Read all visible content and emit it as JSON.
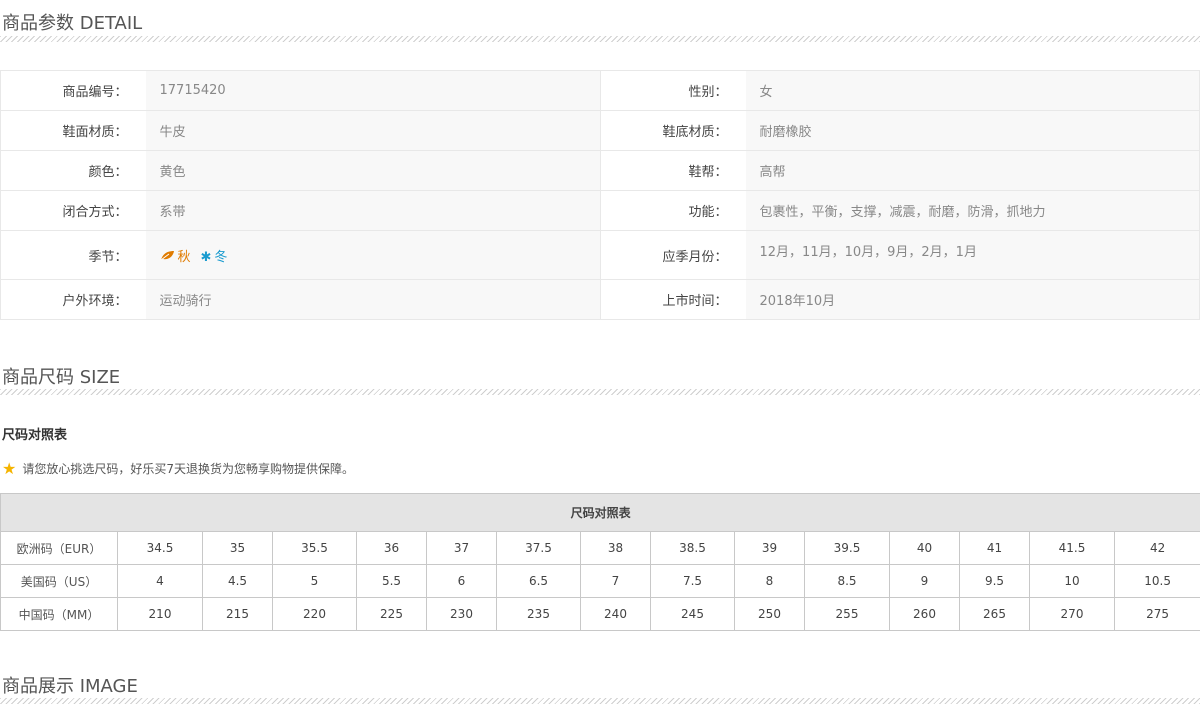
{
  "detail_section": {
    "title": "商品参数 DETAIL"
  },
  "detail": {
    "rows": [
      [
        {
          "k": "商品编号：",
          "v": "17715420"
        },
        {
          "k": "性别：",
          "v": "女"
        }
      ],
      [
        {
          "k": "鞋面材质：",
          "v": "牛皮"
        },
        {
          "k": "鞋底材质：",
          "v": "耐磨橡胶"
        }
      ],
      [
        {
          "k": "颜色：",
          "v": "黄色"
        },
        {
          "k": "鞋帮：",
          "v": "高帮"
        }
      ],
      [
        {
          "k": "闭合方式：",
          "v": "系带"
        },
        {
          "k": "功能：",
          "v": "包裹性，平衡，支撑，减震，耐磨，防滑，抓地力"
        }
      ],
      [
        {
          "k": "季节：",
          "v": ""
        },
        {
          "k": "应季月份：",
          "v": "12月，11月，10月，9月，2月，1月"
        }
      ],
      [
        {
          "k": "户外环境：",
          "v": "运动骑行"
        },
        {
          "k": "上市时间：",
          "v": "2018年10月"
        }
      ]
    ],
    "seasons": [
      {
        "label": "秋",
        "icon": "leaf-icon",
        "color": "#e07b00"
      },
      {
        "label": "冬",
        "icon": "snowflake-icon",
        "color": "#1a9bcf"
      }
    ]
  },
  "size_section": {
    "title": "商品尺码 SIZE",
    "subtitle": "尺码对照表",
    "notice": "请您放心挑选尺码，好乐买7天退换货为您畅享购物提供保障。"
  },
  "size_table": {
    "header": "尺码对照表",
    "rows": [
      {
        "label": "欧洲码（EUR）",
        "values": [
          "34.5",
          "35",
          "35.5",
          "36",
          "37",
          "37.5",
          "38",
          "38.5",
          "39",
          "39.5",
          "40",
          "41",
          "41.5",
          "42"
        ]
      },
      {
        "label": "美国码（US）",
        "values": [
          "4",
          "4.5",
          "5",
          "5.5",
          "6",
          "6.5",
          "7",
          "7.5",
          "8",
          "8.5",
          "9",
          "9.5",
          "10",
          "10.5"
        ]
      },
      {
        "label": "中国码（MM）",
        "values": [
          "210",
          "215",
          "220",
          "225",
          "230",
          "235",
          "240",
          "245",
          "250",
          "255",
          "260",
          "265",
          "270",
          "275"
        ]
      }
    ]
  },
  "image_section": {
    "title": "商品展示 IMAGE"
  }
}
